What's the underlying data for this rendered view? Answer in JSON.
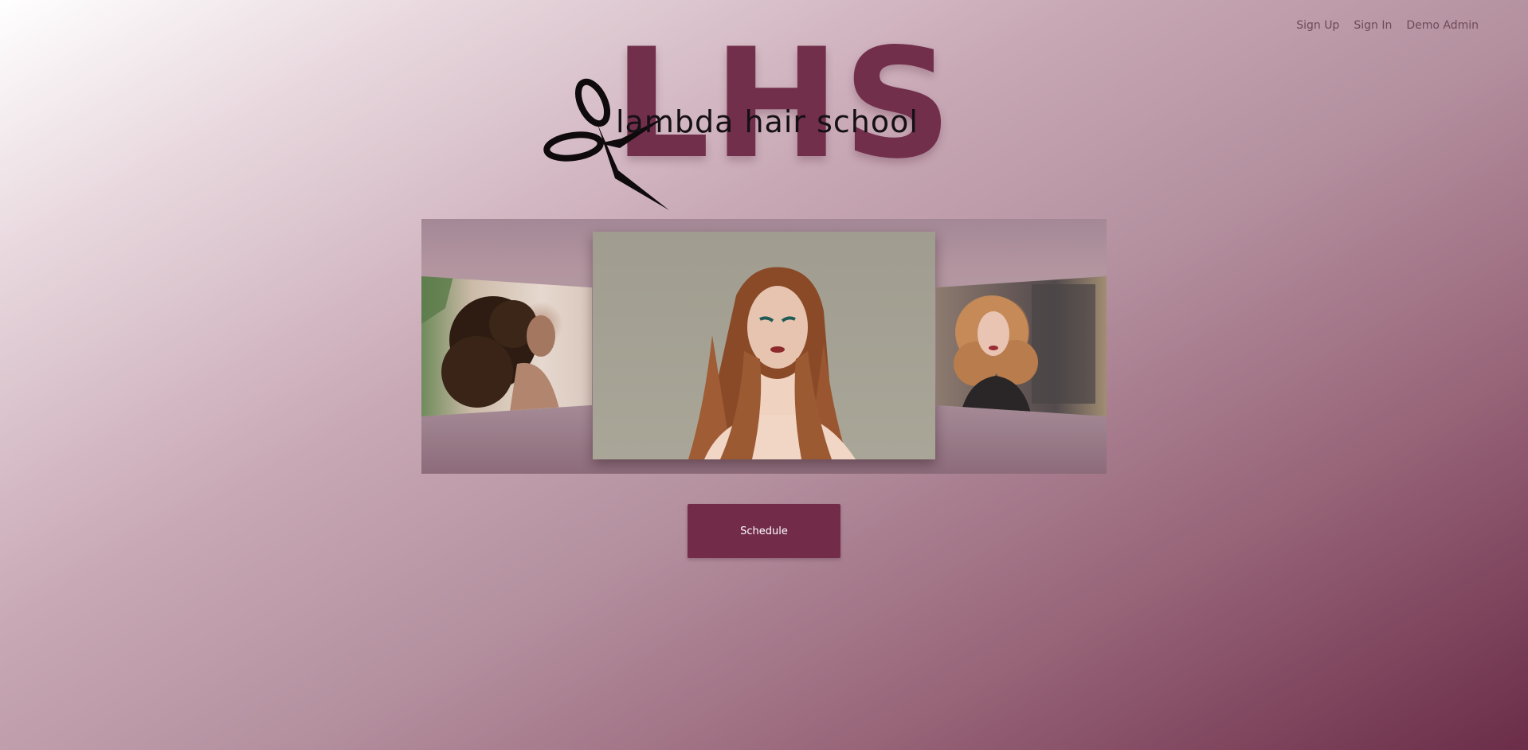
{
  "nav": {
    "links": [
      {
        "label": "Sign Up"
      },
      {
        "label": "Sign In"
      },
      {
        "label": "Demo Admin"
      }
    ]
  },
  "logo": {
    "big_text": "LHS",
    "sub_text": "lambda hair school",
    "brand_color": "#722f4b",
    "icon": "scissors-icon"
  },
  "carousel": {
    "slides": [
      {
        "name": "curly-hair-woman"
      },
      {
        "name": "auburn-straight-hair-woman"
      },
      {
        "name": "blonde-wavy-hair-woman"
      }
    ]
  },
  "actions": {
    "schedule_label": "Schedule",
    "button_color": "#722c4a"
  }
}
